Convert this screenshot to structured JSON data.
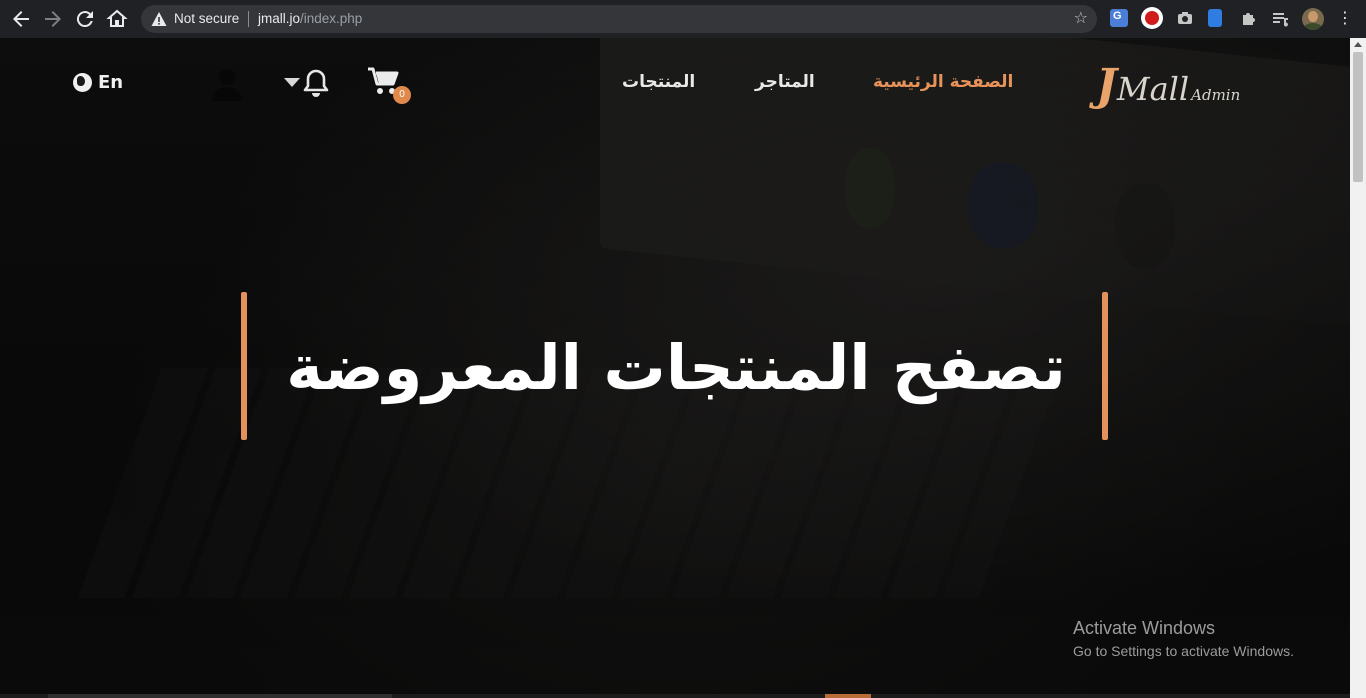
{
  "browser": {
    "back_icon": "arrow-left-icon",
    "forward_icon": "arrow-right-icon",
    "reload_icon": "reload-icon",
    "home_icon": "home-icon",
    "security_label": "Not secure",
    "url_host": "jmall.jo",
    "url_path": "/index.php",
    "bookmark_icon": "star-icon",
    "extensions": [
      "translate-icon",
      "stop-icon",
      "camera-icon",
      "extension-blue-icon",
      "puzzle-icon",
      "media-list-icon"
    ],
    "menu_icon": "more-vert-icon"
  },
  "navbar": {
    "logo": {
      "j": "J",
      "mall": "Mall",
      "admin": "Admin"
    },
    "links": [
      {
        "label": "الصفحة الرئيسية",
        "active": true
      },
      {
        "label": "المتاجر",
        "active": false
      },
      {
        "label": "المنتجات",
        "active": false
      }
    ],
    "cart_count": "0",
    "language": "En",
    "accent_color": "#e2925a"
  },
  "hero": {
    "title": "تصفح المنتجات المعروضة"
  },
  "watermark": {
    "title": "Activate Windows",
    "subtitle": "Go to Settings to activate Windows."
  }
}
